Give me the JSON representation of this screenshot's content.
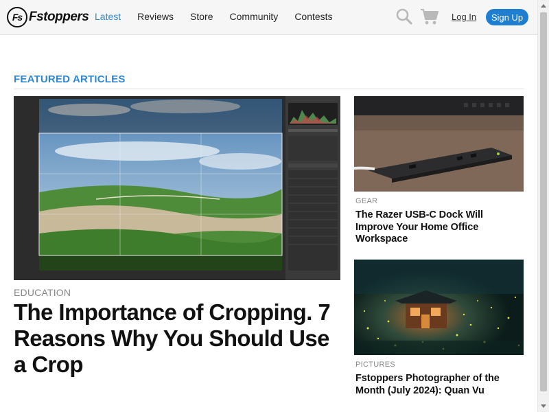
{
  "header": {
    "logo_mark": "Fs",
    "logo_text": "Fstoppers",
    "nav": [
      {
        "label": "Latest",
        "active": true
      },
      {
        "label": "Reviews",
        "active": false
      },
      {
        "label": "Store",
        "active": false
      },
      {
        "label": "Community",
        "active": false
      },
      {
        "label": "Contests",
        "active": false
      }
    ],
    "icons": [
      "search-icon",
      "cart-icon"
    ],
    "login_label": "Log In",
    "signup_label": "Sign Up"
  },
  "section": {
    "title": "FEATURED ARTICLES"
  },
  "featured_main": {
    "category": "EDUCATION",
    "title": "The Importance of Cropping. 7 Reasons Why You Should Use a Crop"
  },
  "featured_side": [
    {
      "category": "GEAR",
      "title": "The Razer USB-C Dock Will Improve Your Home Office Workspace"
    },
    {
      "category": "PICTURES",
      "title": "Fstoppers Photographer of the Month (July 2024): Quan Vu"
    }
  ],
  "colors": {
    "accent": "#2f87d1",
    "signup_bg": "#1f7ed0",
    "header_bg": "#f6f6f6",
    "category_text": "#888888"
  }
}
